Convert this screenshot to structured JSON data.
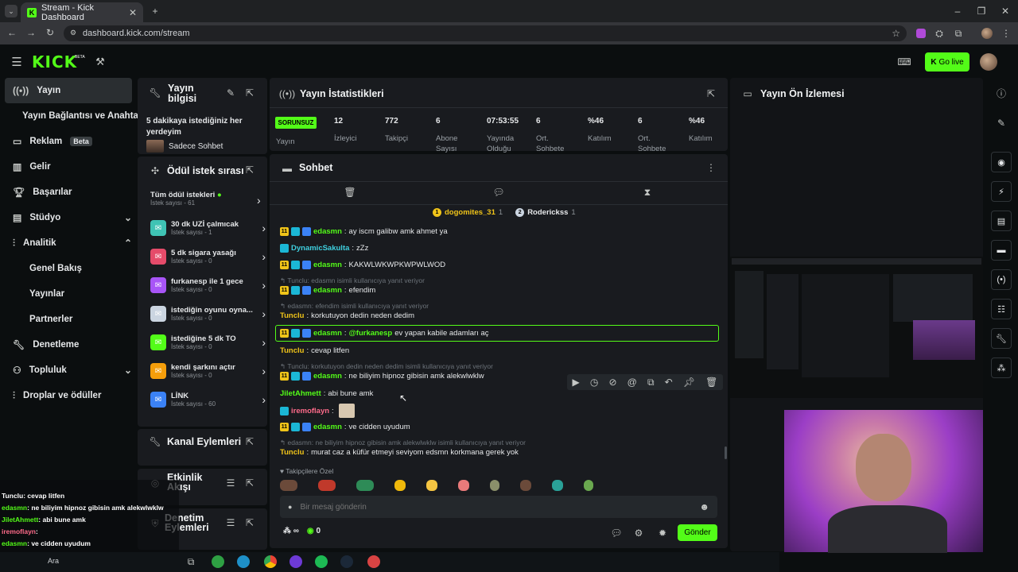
{
  "browser": {
    "tab_title": "Stream - Kick Dashboard",
    "url": "dashboard.kick.com/stream"
  },
  "header": {
    "logo": "KICK",
    "beta": "BETA",
    "go_live": "Go live"
  },
  "sidebar": {
    "items": [
      {
        "label": "Yayın"
      },
      {
        "label": "Yayın Bağlantısı ve Anahtarı"
      },
      {
        "label": "Reklam",
        "badge": "Beta"
      },
      {
        "label": "Gelir"
      },
      {
        "label": "Başarılar"
      },
      {
        "label": "Stüdyo"
      },
      {
        "label": "Analitik"
      },
      {
        "label": "Genel Bakış"
      },
      {
        "label": "Yayınlar"
      },
      {
        "label": "Partnerler"
      },
      {
        "label": "Denetleme"
      },
      {
        "label": "Topluluk"
      },
      {
        "label": "Droplar ve ödüller"
      }
    ]
  },
  "stream_info": {
    "title": "Yayın bilgisi",
    "text": "5 dakikaya istediğiniz her yerdeyim",
    "category": "Sadece Sohbet"
  },
  "rewards": {
    "title": "Ödül istek sırası",
    "all": "Tüm ödül istekleri",
    "all_count": "İstek sayısı - 61",
    "items": [
      {
        "title": "30 dk UZİ çalmıcak",
        "count": "İstek sayısı - 1",
        "color": "#3fc3b4"
      },
      {
        "title": "5 dk sigara yasağı",
        "count": "İstek sayısı - 0",
        "color": "#e54b6a"
      },
      {
        "title": "furkanesp ile 1 gece",
        "count": "İstek sayısı - 0",
        "color": "#a855f7"
      },
      {
        "title": "istediğin oyunu oyna...",
        "count": "İstek sayısı - 0",
        "color": "#cbd5e1"
      },
      {
        "title": "istediğine 5 dk TO",
        "count": "İstek sayısı - 0",
        "color": "#53fc18"
      },
      {
        "title": "kendi şarkını açtır",
        "count": "İstek sayısı - 0",
        "color": "#f59e0b"
      },
      {
        "title": "LİNK",
        "count": "İstek sayısı - 60",
        "color": "#3b82f6"
      }
    ]
  },
  "panels": {
    "channel_actions": "Kanal Eylemleri",
    "activity": "Etkinlik Akışı",
    "mod_actions": "Denetim Eylemleri"
  },
  "stats": {
    "title": "Yayın İstatistikleri",
    "status": "SORUNSUZ",
    "status_label": "Yayın",
    "items": [
      {
        "value": "12",
        "label": "İzleyici"
      },
      {
        "value": "772",
        "label": "Takipçi"
      },
      {
        "value": "6",
        "label": "Abone Sayısı"
      },
      {
        "value": "07:53:55",
        "label": "Yayında Olduğu"
      },
      {
        "value": "6",
        "label": "Ort. Sohbete"
      },
      {
        "value": "%46",
        "label": "Katılım"
      },
      {
        "value": "6",
        "label": "Ort. Sohbete"
      },
      {
        "value": "%46",
        "label": "Katılım"
      }
    ]
  },
  "chat": {
    "title": "Sohbet",
    "pinned": [
      {
        "name": "dogomites_31",
        "n": "1"
      },
      {
        "name": "Roderickss",
        "n": "1"
      }
    ],
    "messages": [
      {
        "user": "edasmn",
        "text": "ay iscm galibw amk ahmet ya"
      },
      {
        "user": "DynamicSakulta",
        "text": "zZz"
      },
      {
        "user": "edasmn",
        "text": "KAKWLWKWPKWPWLWOD"
      },
      {
        "reply": "Tunclu: edasmn isimli kullanıcıya yanıt veriyor",
        "user": "edasmn",
        "text": "efendim"
      },
      {
        "reply": "edasmn: efendim isimli kullanıcıya yanıt veriyor",
        "user": "Tunclu",
        "text": "korkutuyon dedin neden dedim"
      },
      {
        "user": "edasmn",
        "mention": "@furkanesp",
        "text": "ev yapan kabile adamları aç"
      },
      {
        "user": "Tunclu",
        "text": "cevap litfen"
      },
      {
        "reply": "Tunclu: korkutuyon dedin neden dedim isimli kullanıcıya yanıt veriyor",
        "user": "edasmn",
        "text": "ne biliyim hipnoz gibisin amk alekwlwklw"
      },
      {
        "user": "JiletAhmett",
        "text": "abi bune amk"
      },
      {
        "user": "iremoflayn",
        "text": ""
      },
      {
        "user": "edasmn",
        "text": "ve cidden uyudum"
      },
      {
        "reply": "edasmn: ne biliyim hipnoz gibisin amk alekwlwklw isimli kullanıcıya yanıt veriyor",
        "user": "Tunclu",
        "text": "murat caz a küfür etmeyi seviyom edsmn korkmana gerek yok"
      }
    ],
    "followers_only": "Takipçilere Özel",
    "placeholder": "Bir mesaj gönderin",
    "points": "0",
    "infinity": "∞",
    "send": "Gönder"
  },
  "preview": {
    "title": "Yayın Ön İzlemesi"
  },
  "overlay": {
    "lines": [
      {
        "user": "Tunclu",
        "text": ": cevap litfen",
        "color": "#ffffff"
      },
      {
        "user": "edasmn",
        "text": ": ne biliyim hipnoz gibisin amk alekwlwklw",
        "color": "#53fc18"
      },
      {
        "user": "JiletAhmett",
        "text": ": abi bune amk",
        "color": "#53fc18"
      },
      {
        "user": "iremoflayn",
        "text": ":",
        "color": "#ff6b8a"
      },
      {
        "user": "edasmn",
        "text": ": ve cidden uyudum",
        "color": "#53fc18"
      },
      {
        "user": "Tunclu",
        "text": ": murat caz a küfür etmeyi seviyom edsmn korkmana gerek yok",
        "color": "#ffffff"
      }
    ]
  },
  "taskbar": {
    "search": "Ara"
  }
}
